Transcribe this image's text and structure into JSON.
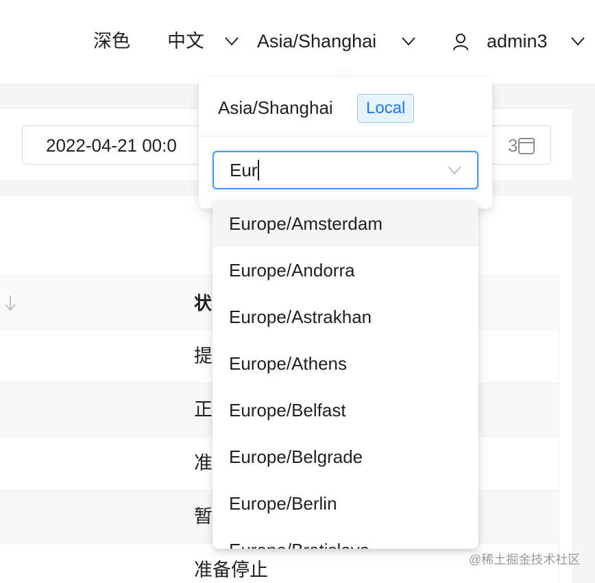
{
  "header": {
    "theme_label": "深色",
    "language_label": "中文",
    "timezone_label": "Asia/Shanghai",
    "username": "admin3"
  },
  "filter": {
    "date_value": "2022-04-21 00:0",
    "date_tail": "3"
  },
  "table": {
    "status_header": "状",
    "rows": [
      "提",
      "正",
      "准",
      "暂",
      "准备停止"
    ]
  },
  "timezone_popover": {
    "current_timezone": "Asia/Shanghai",
    "local_tag": "Local",
    "search_value": "Eur",
    "options": [
      "Europe/Amsterdam",
      "Europe/Andorra",
      "Europe/Astrakhan",
      "Europe/Athens",
      "Europe/Belfast",
      "Europe/Belgrade",
      "Europe/Berlin",
      "Europe/Bratislava"
    ],
    "active_option_index": 0
  },
  "watermark": "@稀土掘金技术社区",
  "colors": {
    "accent": "#4096ff",
    "tag_text": "#1677ff",
    "tag_bg": "#e6f4ff",
    "tag_border": "#91caff"
  }
}
